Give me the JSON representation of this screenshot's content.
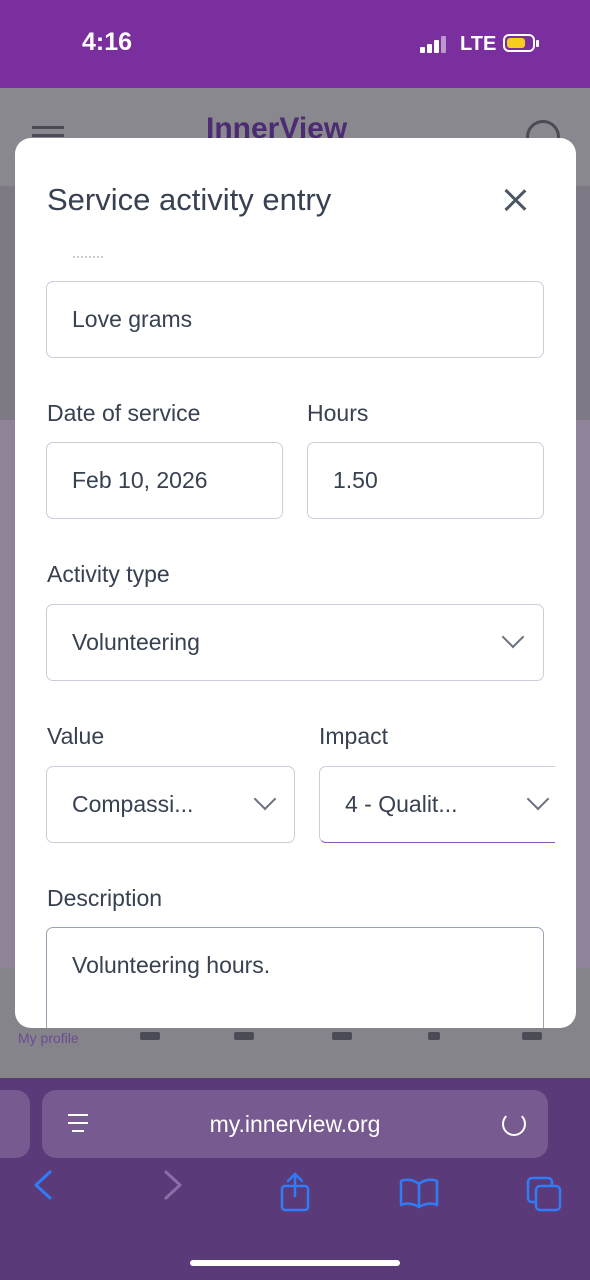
{
  "status_bar": {
    "time": "4:16",
    "network": "LTE"
  },
  "background_page": {
    "logo_text": "InnerView",
    "nav_label": "My profile"
  },
  "modal": {
    "title": "Service activity entry",
    "fields": {
      "activity_name": {
        "value": "Love grams"
      },
      "date_of_service": {
        "label": "Date of service",
        "value": "Feb 10, 2026"
      },
      "hours": {
        "label": "Hours",
        "value": "1.50"
      },
      "activity_type": {
        "label": "Activity type",
        "value": "Volunteering"
      },
      "value": {
        "label": "Value",
        "value": "Compassi..."
      },
      "impact": {
        "label": "Impact",
        "value": "4 - Qualit..."
      },
      "description": {
        "label": "Description",
        "value": "Volunteering hours."
      }
    }
  },
  "browser": {
    "url": "my.innerview.org"
  },
  "colors": {
    "status_bar": "#7b2f9f",
    "browser_chrome": "#5b3a79",
    "accent": "#2f7cf6",
    "battery": "#f6cc1f"
  }
}
